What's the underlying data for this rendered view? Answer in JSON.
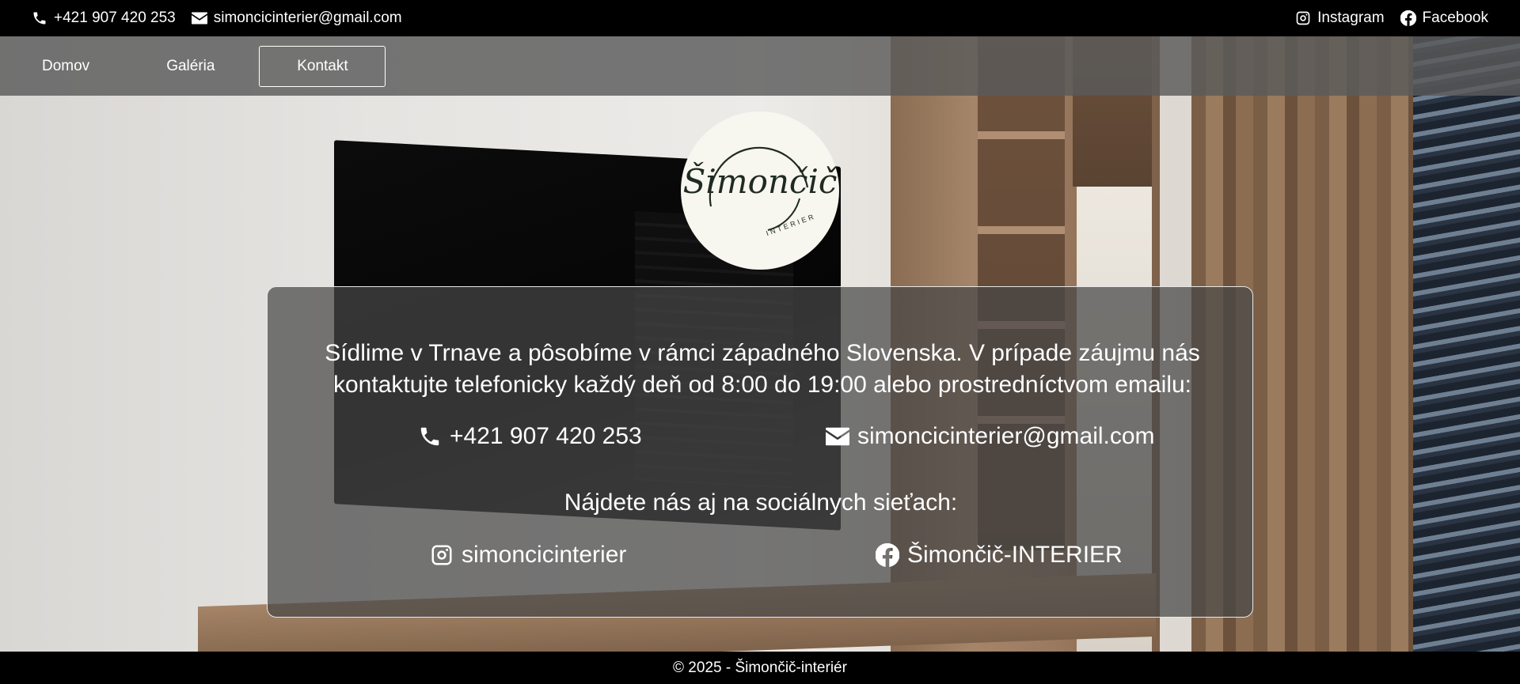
{
  "topbar": {
    "phone": "+421 907 420 253",
    "email": "simoncicinterier@gmail.com",
    "instagram_label": "Instagram",
    "facebook_label": "Facebook"
  },
  "nav": {
    "items": [
      {
        "label": "Domov",
        "active": false
      },
      {
        "label": "Galéria",
        "active": false
      },
      {
        "label": "Kontakt",
        "active": true
      }
    ]
  },
  "logo": {
    "wordmark": "Šimončič",
    "subtitle": "INTERIER"
  },
  "contact": {
    "intro": "Sídlime v Trnave a pôsobíme v rámci západného Slovenska. V prípade záujmu nás kontaktujte telefonicky každý deň od 8:00 do 19:00 alebo prostredníctvom emailu:",
    "phone": "+421 907 420 253",
    "email": "simoncicinterier@gmail.com",
    "social_heading": "Nájdete nás aj na sociálnych sieťach:",
    "instagram_handle": "simoncicinterier",
    "facebook_handle": "Šimončič-INTERIER"
  },
  "footer": {
    "copyright": "© 2025 - Šimončič-interiér"
  },
  "icons": {
    "phone": "phone-icon",
    "email": "envelope-icon",
    "instagram": "instagram-icon",
    "facebook": "facebook-icon"
  },
  "colors": {
    "bar_bg": "#000000",
    "nav_bg": "#5a5a5a",
    "card_bg": "#464646",
    "logo_bg": "#f7f6ef",
    "text": "#ffffff"
  }
}
